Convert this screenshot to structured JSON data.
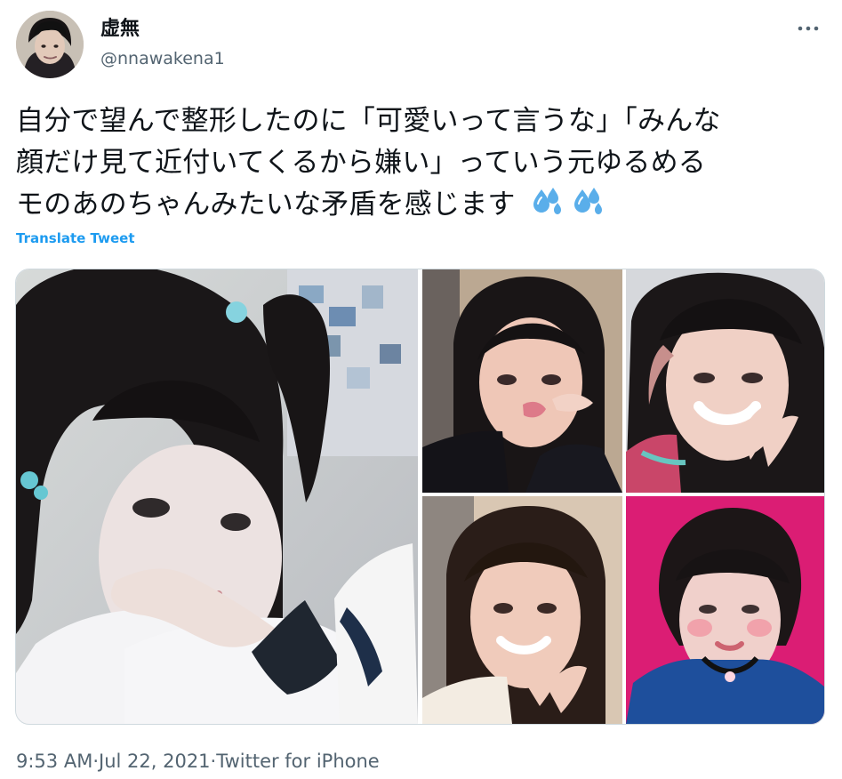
{
  "tweet": {
    "author": {
      "display_name": "虚無",
      "handle": "@nnawakena1"
    },
    "text_lines": [
      "自分で望んで整形したのに「可愛いって言うな」「みんな",
      "顔だけ見て近付いてくるから嫌い」っていう元ゆるめる",
      "モのあのちゃんみたいな矛盾を感じます"
    ],
    "emoji": [
      "sweat-droplets",
      "sweat-droplets"
    ],
    "translate_label": "Translate Tweet",
    "media": [
      {
        "name": "photo-selfie-twin-tails"
      },
      {
        "name": "photo-kiss-face"
      },
      {
        "name": "photo-peace-sign-smile"
      },
      {
        "name": "photo-school-uniform-peace"
      },
      {
        "name": "photo-bob-pink-background"
      }
    ],
    "timestamp": {
      "time": "9:53 AM",
      "separator": " · ",
      "date": "Jul 22, 2021",
      "source": "Twitter for iPhone"
    }
  },
  "colors": {
    "text_primary": "#0f1419",
    "text_secondary": "#536471",
    "link": "#1d9bf0",
    "border": "#cfd9de",
    "emoji": "#5aaeea"
  },
  "icons": {
    "more": "more-dots-icon",
    "emoji": "sweat-droplets-emoji-icon"
  }
}
